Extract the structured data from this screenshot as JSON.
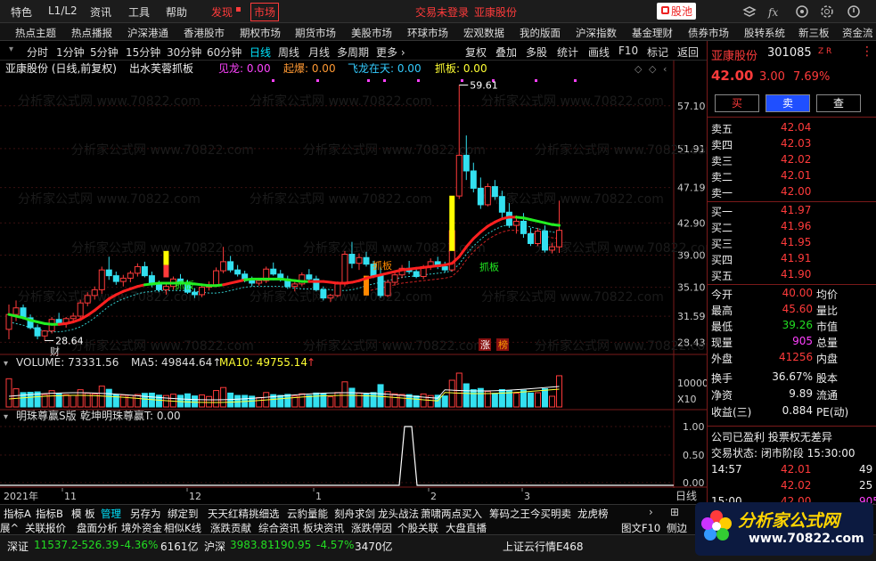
{
  "menu": {
    "left": [
      "特色",
      "L1/L2",
      "资讯",
      "工具",
      "帮助"
    ],
    "discover": "发现",
    "market": "市场",
    "center_left": "交易未登录",
    "center_right": "亚康股份",
    "stock_pool": "股池",
    "icons": [
      "layers-icon",
      "fx-icon",
      "settings-icon",
      "minimize-icon",
      "maximize-icon",
      "close-icon"
    ]
  },
  "nav": [
    "热点主题",
    "热点播报",
    "沪深港通",
    "香港股市",
    "期权市场",
    "期货市场",
    "美股市场",
    "环球市场",
    "宏观数据",
    "我的版面",
    "沪深指数",
    "基金理财",
    "债券市场",
    "股转系统",
    "新三板",
    "资金流"
  ],
  "periods": [
    "分时",
    "1分钟",
    "5分钟",
    "15分钟",
    "30分钟",
    "60分钟",
    "日线",
    "周线",
    "月线",
    "多周期",
    "更多 ›"
  ],
  "active_period": "日线",
  "tools": [
    "复权",
    "叠加",
    "多股",
    "统计",
    "画线",
    "F10",
    "标记",
    "返回"
  ],
  "chart": {
    "title": "亚康股份 (日线,前复权)",
    "indicator": "出水芙蓉抓板",
    "ind_values": [
      {
        "label": "见龙: 0.00",
        "color": "#ff44ff"
      },
      {
        "label": "起爆: 0.00",
        "color": "#ff9933"
      },
      {
        "label": "飞龙在天: 0.00",
        "color": "#33ccff"
      },
      {
        "label": "抓板: 0.00",
        "color": "#ffff33"
      }
    ],
    "y_ticks": [
      "57.10",
      "51.91",
      "47.19",
      "42.90",
      "39.00",
      "35.10",
      "31.59",
      "28.43"
    ],
    "high_mark": "59.61",
    "low_mark": "28.64",
    "labels": {
      "cai": "财",
      "zhua": "抓板",
      "zhang": "涨",
      "bang": "榜",
      "yue": "抓板"
    },
    "watermark": "分析家公式网 www.70822.com"
  },
  "volume": {
    "label": "VOLUME: 73331.56",
    "ma5": "MA5: 49844.64",
    "ma10": "MA10: 49755.14",
    "ticks": [
      "10000",
      "X10"
    ]
  },
  "sub": {
    "label": "明珠尊赢S版",
    "sub": "乾坤明珠尊赢T: 0.00",
    "ticks": [
      "1.00",
      "0.50",
      "0.00"
    ]
  },
  "xaxis": {
    "year": "2021年",
    "months": [
      "11",
      "12",
      "1",
      "2",
      "3"
    ],
    "period_label": "日线"
  },
  "candles": [
    [
      30,
      33,
      28.8,
      31.8
    ],
    [
      31.8,
      33.5,
      31,
      32.6
    ],
    [
      32.6,
      33,
      31.2,
      31.4
    ],
    [
      31.4,
      31.8,
      30,
      30.2
    ],
    [
      30.2,
      30.6,
      28.8,
      29.2
    ],
    [
      29.2,
      29.9,
      28.64,
      29.8
    ],
    [
      29.8,
      31.5,
      29.5,
      31.2
    ],
    [
      31.2,
      32,
      30.5,
      30.8
    ],
    [
      30.8,
      31.5,
      30.2,
      31.3
    ],
    [
      31.3,
      32,
      30.8,
      31.6
    ],
    [
      31.6,
      33.6,
      31.3,
      33.2
    ],
    [
      33.2,
      34.5,
      32.8,
      34.1
    ],
    [
      34.1,
      35.2,
      33.6,
      34.8
    ],
    [
      34.8,
      37.6,
      34.3,
      37.2
    ],
    [
      37.2,
      38.8,
      36,
      36.5
    ],
    [
      36.5,
      37,
      35.4,
      35.8
    ],
    [
      35.8,
      36.6,
      35.2,
      36.2
    ],
    [
      36.2,
      37.1,
      35.7,
      36.8
    ],
    [
      36.8,
      38,
      36.4,
      37.6
    ],
    [
      37.6,
      38.2,
      36.3,
      36.5
    ],
    [
      36.5,
      37,
      35.1,
      35.4
    ],
    [
      35.4,
      35.9,
      34.5,
      34.8
    ],
    [
      34.8,
      35.5,
      34.2,
      35.2
    ],
    [
      35.2,
      36.4,
      34.8,
      36.1
    ],
    [
      36.1,
      36.7,
      35.3,
      35.6
    ],
    [
      35.6,
      36,
      34.3,
      34.5
    ],
    [
      34.5,
      35,
      33.8,
      34.2
    ],
    [
      34.2,
      35.3,
      33.9,
      35.1
    ],
    [
      35.1,
      35.8,
      34.7,
      35.4
    ],
    [
      35.4,
      37.5,
      35.1,
      37.1
    ],
    [
      37.1,
      40,
      36.8,
      38.2
    ],
    [
      38.2,
      38.9,
      36.9,
      37.2
    ],
    [
      37.2,
      37.8,
      36.4,
      36.7
    ],
    [
      36.7,
      37.1,
      35.7,
      35.9
    ],
    [
      35.9,
      36.4,
      35.2,
      35.6
    ],
    [
      35.6,
      36.2,
      35.3,
      35.9
    ],
    [
      35.9,
      37.6,
      35.6,
      37.3
    ],
    [
      37.3,
      38.1,
      36.5,
      36.7
    ],
    [
      36.7,
      37.2,
      35.8,
      36.1
    ],
    [
      36.1,
      36.5,
      34.9,
      35.2
    ],
    [
      35.2,
      35.8,
      34.6,
      35.5
    ],
    [
      35.5,
      36.9,
      35.2,
      36.6
    ],
    [
      36.6,
      37.3,
      35.9,
      36.1
    ],
    [
      36.1,
      36.5,
      34.6,
      34.8
    ],
    [
      34.8,
      35.2,
      33.5,
      33.8
    ],
    [
      33.8,
      34.3,
      33.3,
      34.1
    ],
    [
      34.1,
      35.8,
      33.9,
      35.5
    ],
    [
      35.5,
      39.5,
      35.2,
      39.1
    ],
    [
      39.1,
      40.6,
      37.4,
      38
    ],
    [
      38,
      39.2,
      37.2,
      38.7
    ],
    [
      38.7,
      39.4,
      37.6,
      37.9
    ],
    [
      37.9,
      38.3,
      36.2,
      36.5
    ],
    [
      36.5,
      37.6,
      33.8,
      34.1
    ],
    [
      34.1,
      36,
      33.9,
      35.7
    ],
    [
      35.7,
      37,
      35.3,
      36.6
    ],
    [
      36.6,
      37.8,
      36.2,
      37.4
    ],
    [
      37.4,
      38.3,
      36.7,
      37
    ],
    [
      37,
      37.5,
      36.2,
      36.4
    ],
    [
      36.4,
      37.8,
      36.1,
      37.6
    ],
    [
      37.6,
      38.6,
      37.2,
      38.2
    ],
    [
      38.2,
      38.8,
      37.3,
      37.6
    ],
    [
      37.6,
      38.2,
      36.9,
      37.2
    ],
    [
      37.2,
      42,
      37,
      41.96
    ],
    [
      46.16,
      59.61,
      45.8,
      51.1
    ],
    [
      51.1,
      53.5,
      48.1,
      49.2
    ],
    [
      49.2,
      50.2,
      46.6,
      47.1
    ],
    [
      47.1,
      48.4,
      44.6,
      45.1
    ],
    [
      45.1,
      47.7,
      44.9,
      47.3
    ],
    [
      47.3,
      48.1,
      45.7,
      46.1
    ],
    [
      46.1,
      46.8,
      43.4,
      44.2
    ],
    [
      44.2,
      45.3,
      42.3,
      42.6
    ],
    [
      42.6,
      43.8,
      41.6,
      43.1
    ],
    [
      43.1,
      44.1,
      41.1,
      41.6
    ],
    [
      41.6,
      42.3,
      40.1,
      40.4
    ],
    [
      40.4,
      42.3,
      40.1,
      41.9
    ],
    [
      41.9,
      42.6,
      39.3,
      39.6
    ],
    [
      39.6,
      40.5,
      39.2,
      40
    ],
    [
      40,
      45.6,
      39.26,
      42
    ]
  ],
  "ma_line": [
    31.8,
    31.6,
    31.4,
    31.1,
    30.9,
    30.7,
    30.6,
    30.6,
    30.7,
    30.9,
    31.2,
    31.7,
    32.3,
    33,
    33.7,
    34.2,
    34.6,
    34.9,
    35.2,
    35.4,
    35.5,
    35.6,
    35.6,
    35.6,
    35.6,
    35.6,
    35.5,
    35.4,
    35.3,
    35.3,
    35.4,
    35.6,
    35.8,
    36,
    36.1,
    36.1,
    36.1,
    36.1,
    36.1,
    36,
    35.9,
    35.8,
    35.8,
    35.8,
    35.8,
    35.7,
    35.6,
    35.6,
    35.7,
    35.9,
    36.2,
    36.4,
    36.6,
    36.8,
    37,
    37.2,
    37.3,
    37.4,
    37.5,
    37.6,
    37.7,
    37.8,
    38,
    38.8,
    40,
    41,
    41.8,
    42.5,
    43,
    43.4,
    43.6,
    43.6,
    43.5,
    43.3,
    43.1,
    42.9,
    42.7,
    42.6
  ],
  "ma_color": [
    "g",
    "g",
    "g",
    "g",
    "g",
    "g",
    "g",
    "r",
    "r",
    "r",
    "r",
    "r",
    "r",
    "r",
    "r",
    "r",
    "r",
    "r",
    "r",
    "g",
    "g",
    "g",
    "g",
    "g",
    "g",
    "g",
    "g",
    "g",
    "g",
    "g",
    "r",
    "r",
    "r",
    "g",
    "g",
    "g",
    "g",
    "g",
    "g",
    "g",
    "g",
    "g",
    "r",
    "r",
    "r",
    "r",
    "r",
    "r",
    "r",
    "r",
    "r",
    "r",
    "r",
    "r",
    "r",
    "r",
    "r",
    "r",
    "r",
    "r",
    "r",
    "r",
    "r",
    "r",
    "r",
    "r",
    "r",
    "r",
    "r",
    "r",
    "r",
    "g",
    "g",
    "g",
    "g",
    "g",
    "g",
    "g"
  ],
  "order_book": {
    "stock_name": "亚康股份",
    "stock_code": "301085",
    "tag": "Z R",
    "price": "42.00",
    "change": "3.00",
    "pct": "7.69%",
    "buttons": [
      "买",
      "卖",
      "查"
    ],
    "asks": [
      {
        "label": "卖五",
        "price": "42.04"
      },
      {
        "label": "卖四",
        "price": "42.03"
      },
      {
        "label": "卖三",
        "price": "42.02"
      },
      {
        "label": "卖二",
        "price": "42.01"
      },
      {
        "label": "卖一",
        "price": "42.00"
      }
    ],
    "bids": [
      {
        "label": "买一",
        "price": "41.97"
      },
      {
        "label": "买二",
        "price": "41.96"
      },
      {
        "label": "买三",
        "price": "41.95"
      },
      {
        "label": "买四",
        "price": "41.91"
      },
      {
        "label": "买五",
        "price": "41.90"
      }
    ],
    "stats": [
      {
        "l": "今开",
        "v": "40.00",
        "r": "均价"
      },
      {
        "l": "最高",
        "v": "45.60",
        "r": "量比"
      },
      {
        "l": "最低",
        "v": "39.26",
        "r": "市值"
      },
      {
        "l": "现量",
        "v": "905",
        "r": "总量"
      },
      {
        "l": "外盘",
        "v": "41256",
        "r": "内盘"
      }
    ],
    "stats2": [
      {
        "l": "换手",
        "v": "36.67%",
        "r": "股本"
      },
      {
        "l": "净资",
        "v": "9.89",
        "r": "流通"
      },
      {
        "l": "收益(三)",
        "v": "0.884",
        "r": "PE(动)"
      }
    ],
    "company": "公司已盈利 投票权无差异",
    "status": "交易状态: 闭市阶段 15:30:00",
    "ticks": [
      {
        "t": "14:57",
        "p": "42.01",
        "v": "49"
      },
      {
        "t": "",
        "p": "42.02",
        "v": "25"
      },
      {
        "t": "15:00",
        "p": "42.00",
        "v": "905"
      }
    ]
  },
  "bottom_tabs": [
    "指标A",
    "指标B",
    "模 板",
    "管理",
    "另存为",
    "绑定到",
    "天天红精挑细选",
    "云豹量能",
    "刻舟求剑",
    "龙头战法",
    "萧啸两点买入",
    "筹码之王",
    "今买明卖",
    "龙虎榜"
  ],
  "bottom_row2": [
    "展^",
    "关联报价",
    "盘面分析",
    "境外资金",
    "相似K线",
    "涨跌贡献",
    "综合资讯",
    "板块资讯",
    "涨跌停因",
    "个股关联",
    "大盘直播"
  ],
  "bottom_right2": [
    "图文F10",
    "侧边"
  ],
  "status": {
    "sz_label": "深证",
    "sz_val": "11537.2",
    "sz_chg": "-526.39",
    "sz_pct": "-4.36%",
    "sz_amt": "6161亿",
    "hs_label": "沪深",
    "hs_val": "3983.81",
    "hs_chg": "-190.95",
    "hs_pct": "-4.57%",
    "hs_amt": "3470亿",
    "server": "上证云行情E468"
  },
  "logo_text": "分析家公式网",
  "logo_url": "www.70822.com"
}
